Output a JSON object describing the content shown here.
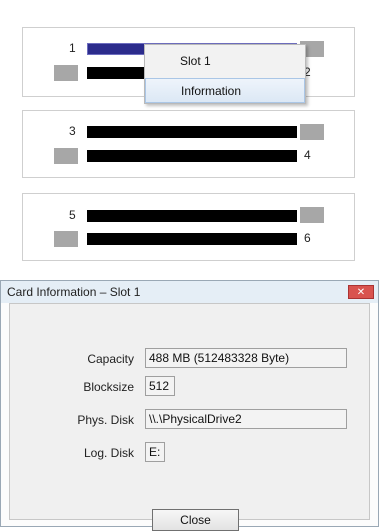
{
  "slots": [
    {
      "top_number": "1",
      "bottom_number": "2"
    },
    {
      "top_number": "3",
      "bottom_number": "4"
    },
    {
      "top_number": "5",
      "bottom_number": "6"
    }
  ],
  "context_menu": {
    "items": [
      "Slot 1",
      "Information"
    ],
    "highlighted": "Information"
  },
  "dialog": {
    "title": "Card Information – Slot 1",
    "close_glyph": "✕",
    "fields": {
      "capacity": {
        "label": "Capacity",
        "value": "488 MB  (512483328 Byte)"
      },
      "blocksize": {
        "label": "Blocksize",
        "value": "512"
      },
      "phys_disk": {
        "label": "Phys. Disk",
        "value": "\\\\.\\PhysicalDrive2"
      },
      "log_disk": {
        "label": "Log. Disk",
        "value": "E:"
      }
    },
    "close_button": "Close"
  },
  "colors": {
    "bar": "#000000",
    "selected_bar": "#2c2c8c",
    "led": "#a7a7a7",
    "close_button": "#d9534f"
  }
}
